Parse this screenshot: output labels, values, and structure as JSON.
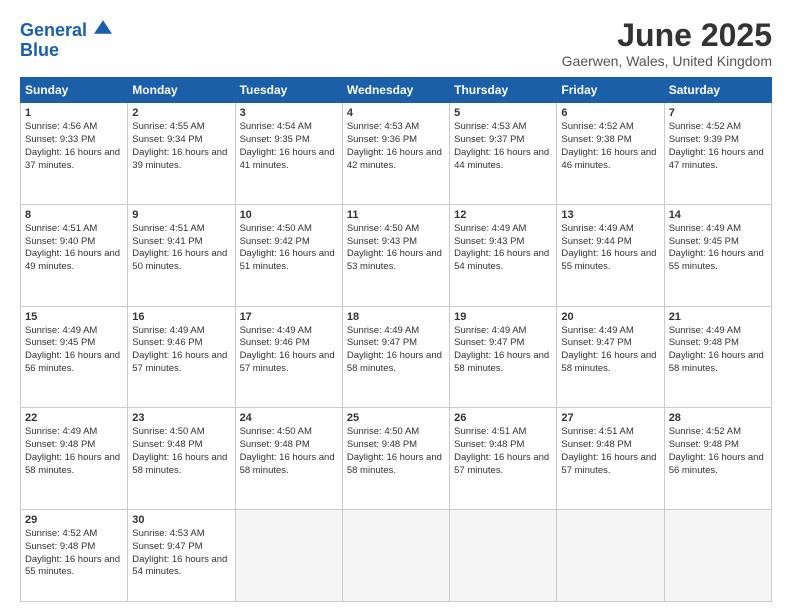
{
  "logo": {
    "line1": "General",
    "line2": "Blue"
  },
  "title": "June 2025",
  "location": "Gaerwen, Wales, United Kingdom",
  "days_of_week": [
    "Sunday",
    "Monday",
    "Tuesday",
    "Wednesday",
    "Thursday",
    "Friday",
    "Saturday"
  ],
  "weeks": [
    [
      {
        "day": "1",
        "sunrise": "Sunrise: 4:56 AM",
        "sunset": "Sunset: 9:33 PM",
        "daylight": "Daylight: 16 hours and 37 minutes."
      },
      {
        "day": "2",
        "sunrise": "Sunrise: 4:55 AM",
        "sunset": "Sunset: 9:34 PM",
        "daylight": "Daylight: 16 hours and 39 minutes."
      },
      {
        "day": "3",
        "sunrise": "Sunrise: 4:54 AM",
        "sunset": "Sunset: 9:35 PM",
        "daylight": "Daylight: 16 hours and 41 minutes."
      },
      {
        "day": "4",
        "sunrise": "Sunrise: 4:53 AM",
        "sunset": "Sunset: 9:36 PM",
        "daylight": "Daylight: 16 hours and 42 minutes."
      },
      {
        "day": "5",
        "sunrise": "Sunrise: 4:53 AM",
        "sunset": "Sunset: 9:37 PM",
        "daylight": "Daylight: 16 hours and 44 minutes."
      },
      {
        "day": "6",
        "sunrise": "Sunrise: 4:52 AM",
        "sunset": "Sunset: 9:38 PM",
        "daylight": "Daylight: 16 hours and 46 minutes."
      },
      {
        "day": "7",
        "sunrise": "Sunrise: 4:52 AM",
        "sunset": "Sunset: 9:39 PM",
        "daylight": "Daylight: 16 hours and 47 minutes."
      }
    ],
    [
      {
        "day": "8",
        "sunrise": "Sunrise: 4:51 AM",
        "sunset": "Sunset: 9:40 PM",
        "daylight": "Daylight: 16 hours and 49 minutes."
      },
      {
        "day": "9",
        "sunrise": "Sunrise: 4:51 AM",
        "sunset": "Sunset: 9:41 PM",
        "daylight": "Daylight: 16 hours and 50 minutes."
      },
      {
        "day": "10",
        "sunrise": "Sunrise: 4:50 AM",
        "sunset": "Sunset: 9:42 PM",
        "daylight": "Daylight: 16 hours and 51 minutes."
      },
      {
        "day": "11",
        "sunrise": "Sunrise: 4:50 AM",
        "sunset": "Sunset: 9:43 PM",
        "daylight": "Daylight: 16 hours and 53 minutes."
      },
      {
        "day": "12",
        "sunrise": "Sunrise: 4:49 AM",
        "sunset": "Sunset: 9:43 PM",
        "daylight": "Daylight: 16 hours and 54 minutes."
      },
      {
        "day": "13",
        "sunrise": "Sunrise: 4:49 AM",
        "sunset": "Sunset: 9:44 PM",
        "daylight": "Daylight: 16 hours and 55 minutes."
      },
      {
        "day": "14",
        "sunrise": "Sunrise: 4:49 AM",
        "sunset": "Sunset: 9:45 PM",
        "daylight": "Daylight: 16 hours and 55 minutes."
      }
    ],
    [
      {
        "day": "15",
        "sunrise": "Sunrise: 4:49 AM",
        "sunset": "Sunset: 9:45 PM",
        "daylight": "Daylight: 16 hours and 56 minutes."
      },
      {
        "day": "16",
        "sunrise": "Sunrise: 4:49 AM",
        "sunset": "Sunset: 9:46 PM",
        "daylight": "Daylight: 16 hours and 57 minutes."
      },
      {
        "day": "17",
        "sunrise": "Sunrise: 4:49 AM",
        "sunset": "Sunset: 9:46 PM",
        "daylight": "Daylight: 16 hours and 57 minutes."
      },
      {
        "day": "18",
        "sunrise": "Sunrise: 4:49 AM",
        "sunset": "Sunset: 9:47 PM",
        "daylight": "Daylight: 16 hours and 58 minutes."
      },
      {
        "day": "19",
        "sunrise": "Sunrise: 4:49 AM",
        "sunset": "Sunset: 9:47 PM",
        "daylight": "Daylight: 16 hours and 58 minutes."
      },
      {
        "day": "20",
        "sunrise": "Sunrise: 4:49 AM",
        "sunset": "Sunset: 9:47 PM",
        "daylight": "Daylight: 16 hours and 58 minutes."
      },
      {
        "day": "21",
        "sunrise": "Sunrise: 4:49 AM",
        "sunset": "Sunset: 9:48 PM",
        "daylight": "Daylight: 16 hours and 58 minutes."
      }
    ],
    [
      {
        "day": "22",
        "sunrise": "Sunrise: 4:49 AM",
        "sunset": "Sunset: 9:48 PM",
        "daylight": "Daylight: 16 hours and 58 minutes."
      },
      {
        "day": "23",
        "sunrise": "Sunrise: 4:50 AM",
        "sunset": "Sunset: 9:48 PM",
        "daylight": "Daylight: 16 hours and 58 minutes."
      },
      {
        "day": "24",
        "sunrise": "Sunrise: 4:50 AM",
        "sunset": "Sunset: 9:48 PM",
        "daylight": "Daylight: 16 hours and 58 minutes."
      },
      {
        "day": "25",
        "sunrise": "Sunrise: 4:50 AM",
        "sunset": "Sunset: 9:48 PM",
        "daylight": "Daylight: 16 hours and 58 minutes."
      },
      {
        "day": "26",
        "sunrise": "Sunrise: 4:51 AM",
        "sunset": "Sunset: 9:48 PM",
        "daylight": "Daylight: 16 hours and 57 minutes."
      },
      {
        "day": "27",
        "sunrise": "Sunrise: 4:51 AM",
        "sunset": "Sunset: 9:48 PM",
        "daylight": "Daylight: 16 hours and 57 minutes."
      },
      {
        "day": "28",
        "sunrise": "Sunrise: 4:52 AM",
        "sunset": "Sunset: 9:48 PM",
        "daylight": "Daylight: 16 hours and 56 minutes."
      }
    ],
    [
      {
        "day": "29",
        "sunrise": "Sunrise: 4:52 AM",
        "sunset": "Sunset: 9:48 PM",
        "daylight": "Daylight: 16 hours and 55 minutes."
      },
      {
        "day": "30",
        "sunrise": "Sunrise: 4:53 AM",
        "sunset": "Sunset: 9:47 PM",
        "daylight": "Daylight: 16 hours and 54 minutes."
      },
      null,
      null,
      null,
      null,
      null
    ]
  ]
}
